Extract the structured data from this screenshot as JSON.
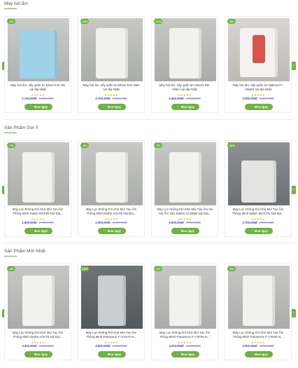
{
  "sections": [
    {
      "title": "Máy hút ẩm",
      "products": [
        {
          "badge": "-6%",
          "name": "Máy hút ẩm, sấy quần áo Eheel EJC-65 nội địa Nhật",
          "price": "2.700.000đ",
          "old_price": "2.900.000đ",
          "stars": "★★★★★",
          "buy": "Mua ngay",
          "theme": "blue"
        },
        {
          "badge": "-10%",
          "name": "Máy hút ẩm, sấy quần áo Eheel EJC-65N nội địa Nhật",
          "price": "2.700.000đ",
          "old_price": "3.000.000đ",
          "stars": "★★★★★",
          "buy": "Mua ngay",
          "theme": "white"
        },
        {
          "badge": "-11%",
          "name": "Máy hút ẩm, sấy quần áo Hitachi RD-H56A nội địa Nhật",
          "price": "2.400.000đ",
          "old_price": "2.700.000đ",
          "stars": "★★★★★",
          "buy": "Mua ngay",
          "theme": "white"
        },
        {
          "badge": "-8%",
          "name": "Máy hút ẩm, sấy quần áo National F-Y96KS nội địa Nhật",
          "price": "3.000.000đ",
          "old_price": "3.250.000đ",
          "stars": "★★★★★",
          "buy": "Mua ngay",
          "theme": "red"
        }
      ]
    },
    {
      "title": "Sản Phẩm Gợi Ý",
      "products": [
        {
          "badge": "-7%",
          "name": "Máy Lọc Không Khí Khử Mùi Tạo Ẩm Thông Minh Daikin MCK55 Nội Địa...",
          "price": "2.500.000đ",
          "old_price": "2.700.000đ",
          "stars": "★★★★★",
          "buy": "Mua ngay",
          "theme": "white"
        },
        {
          "badge": "-8%",
          "name": "Máy Lọc Không Khí Khử Mùi Tạo Ẩm Thông Minh Daikin ACK55 Nội Địa...",
          "price": "2.300.000đ",
          "old_price": "2.500.000đ",
          "stars": "★★★★★",
          "buy": "Mua ngay",
          "theme": "white"
        },
        {
          "badge": "-7%",
          "name": "Máy Lọc Không Khí Khử Mùi Tạo Ẩm Và Hút Ẩm 3in1 Daikin ACZ65M Nội Địa...",
          "price": "6.500.000đ",
          "old_price": "7.000.000đ",
          "stars": "★★★★★",
          "buy": "Mua ngay",
          "theme": "white"
        },
        {
          "badge": "-11%",
          "name": "Máy Lọc Không Khí Khử Mùi Tạo Ẩm Thông Minh Daikin MCK70L Nội Địa...",
          "price": "2.700.000đ",
          "old_price": "3.000.000đ",
          "stars": "★★★★★",
          "buy": "Mua ngay",
          "theme": "grey"
        }
      ]
    },
    {
      "title": "Sản Phẩm Mới Nhất",
      "products": [
        {
          "badge": "-4%",
          "name": "Máy Lọc Không Khí Khử Mùi Tạo Ẩm Thông Minh Daikin ACK75 Nội Địa...",
          "price": "4.300.000đ",
          "old_price": "4.500.000đ",
          "stars": "★★★★★",
          "buy": "Mua ngay",
          "theme": "white"
        },
        {
          "badge": "-10%",
          "name": "Máy Lọc Không Khí Khử Mùi Tạo Ẩm Thông Minh Panasonic F-VXS70 N...",
          "price": "4.500.000đ",
          "old_price": "5.000.000đ",
          "stars": "★★★★★",
          "buy": "Mua ngay",
          "theme": "slate"
        },
        {
          "badge": "-2%",
          "name": "Máy Lọc Không Khí Khử Mùi Tạo Ẩm Thông Minh Panasonic F-VXF65 N...",
          "price": "4.200.000đ",
          "old_price": "4.300.000đ",
          "stars": "★★★★★",
          "buy": "Mua ngay",
          "theme": "white"
        },
        {
          "badge": "-4%",
          "name": "Máy Lọc Không Khí Khử Mùi Tạo Ẩm Thông Minh Panasonic F-VXF60 N...",
          "price": "4.000.000đ",
          "old_price": "4.200.000đ",
          "stars": "★★★★★",
          "buy": "Mua ngay",
          "theme": "white"
        }
      ]
    }
  ],
  "nav": {
    "prev_icon": "‹",
    "next_icon": "›"
  },
  "icons": {
    "cart": "🛒"
  },
  "colors": {
    "accent": "#6cb33f",
    "price": "#2b3cd6",
    "stars": "#f5a623"
  }
}
